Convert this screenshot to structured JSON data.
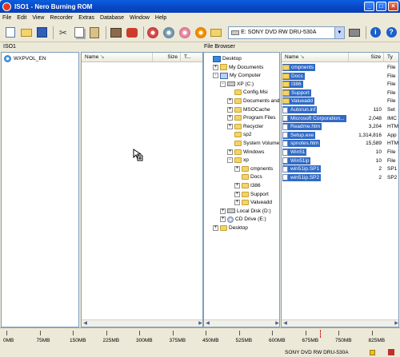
{
  "window": {
    "title": "ISO1 - Nero Burning ROM",
    "min": "_",
    "max": "□",
    "close": "×"
  },
  "menu": [
    "File",
    "Edit",
    "View",
    "Recorder",
    "Extras",
    "Database",
    "Window",
    "Help"
  ],
  "toolbar": {
    "drive": "E: SONY    DVD RW DRU-530A"
  },
  "iso_pane": {
    "label": "ISO1",
    "root": "WXPVOL_EN",
    "columns": [
      "Name",
      "Size",
      "T..."
    ]
  },
  "browser": {
    "label": "File Browser",
    "tree": [
      {
        "label": "Desktop",
        "icon": "desktop",
        "indent": 0,
        "exp": ""
      },
      {
        "label": "My Documents",
        "icon": "docs",
        "indent": 1,
        "exp": "+"
      },
      {
        "label": "My Computer",
        "icon": "pc",
        "indent": 1,
        "exp": "−"
      },
      {
        "label": "XP (C:)",
        "icon": "drive",
        "indent": 2,
        "exp": "−"
      },
      {
        "label": "Config.Msi",
        "icon": "folder",
        "indent": 3,
        "exp": ""
      },
      {
        "label": "Documents and",
        "icon": "folder",
        "indent": 3,
        "exp": "+"
      },
      {
        "label": "MSOCache",
        "icon": "folder",
        "indent": 3,
        "exp": "+"
      },
      {
        "label": "Program Files",
        "icon": "folder",
        "indent": 3,
        "exp": "+"
      },
      {
        "label": "Recycler",
        "icon": "folder",
        "indent": 3,
        "exp": "+"
      },
      {
        "label": "sp2",
        "icon": "folder",
        "indent": 3,
        "exp": ""
      },
      {
        "label": "System Volume",
        "icon": "folder",
        "indent": 3,
        "exp": ""
      },
      {
        "label": "Windows",
        "icon": "folder",
        "indent": 3,
        "exp": "+"
      },
      {
        "label": "xp",
        "icon": "folder",
        "indent": 3,
        "exp": "−"
      },
      {
        "label": "cmpnents",
        "icon": "folder",
        "indent": 4,
        "exp": "+"
      },
      {
        "label": "Docs",
        "icon": "folder",
        "indent": 4,
        "exp": ""
      },
      {
        "label": "I386",
        "icon": "folder",
        "indent": 4,
        "exp": "+"
      },
      {
        "label": "Support",
        "icon": "folder",
        "indent": 4,
        "exp": "+"
      },
      {
        "label": "Valueadd",
        "icon": "folder",
        "indent": 4,
        "exp": "+"
      },
      {
        "label": "Local Disk (D:)",
        "icon": "drive",
        "indent": 2,
        "exp": "+"
      },
      {
        "label": "CD Drive (E:)",
        "icon": "cd",
        "indent": 2,
        "exp": "+"
      },
      {
        "label": "Desktop",
        "icon": "folder",
        "indent": 1,
        "exp": "+"
      }
    ],
    "columns": [
      "Name",
      "Size",
      "Ty"
    ],
    "files": [
      {
        "name": "cmpnents",
        "size": "",
        "type": "File",
        "icon": "folder"
      },
      {
        "name": "Docs",
        "size": "",
        "type": "File",
        "icon": "folder"
      },
      {
        "name": "I386",
        "size": "",
        "type": "File",
        "icon": "folder"
      },
      {
        "name": "Support",
        "size": "",
        "type": "File",
        "icon": "folder"
      },
      {
        "name": "Valueadd",
        "size": "",
        "type": "File",
        "icon": "folder"
      },
      {
        "name": "Autorun.inf",
        "size": "110",
        "type": "Set",
        "icon": "file"
      },
      {
        "name": "Microsoft Corporation...",
        "size": "2,048",
        "type": "IMC",
        "icon": "file"
      },
      {
        "name": "Readme.htm",
        "size": "3,204",
        "type": "HTM",
        "icon": "file"
      },
      {
        "name": "Setup.exe",
        "size": "1,314,816",
        "type": "App",
        "icon": "file"
      },
      {
        "name": "spnotes.htm",
        "size": "15,589",
        "type": "HTM",
        "icon": "file"
      },
      {
        "name": "Win51",
        "size": "10",
        "type": "File",
        "icon": "file"
      },
      {
        "name": "Win51ip",
        "size": "10",
        "type": "File",
        "icon": "file"
      },
      {
        "name": "win51ip.SP1",
        "size": "2",
        "type": "SP1",
        "icon": "file"
      },
      {
        "name": "win51ip.SP2",
        "size": "2",
        "type": "SP2",
        "icon": "file"
      }
    ]
  },
  "scale": [
    "0MB",
    "75MB",
    "150MB",
    "225MB",
    "300MB",
    "375MB",
    "450MB",
    "525MB",
    "600MB",
    "675MB",
    "750MB",
    "825MB"
  ],
  "status": {
    "drive": "SONY    DVD RW DRU-530A"
  }
}
